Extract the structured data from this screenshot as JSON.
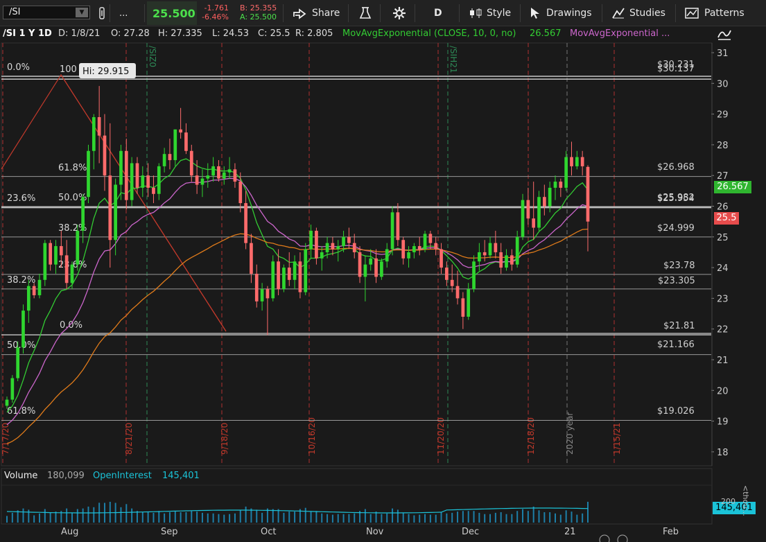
{
  "toolbar": {
    "symbol": "/SI",
    "ellipsis": "...",
    "last": "25.500",
    "net_change": "-1.761",
    "pct_change": "-6.46%",
    "bid": "B: 25.355",
    "ask": "A: 25.500",
    "share": "Share",
    "aggregation": "D",
    "style": "Style",
    "drawings": "Drawings",
    "studies": "Studies",
    "patterns": "Patterns"
  },
  "info": {
    "symbol_period": "/SI 1 Y 1D",
    "date": "D: 1/8/21",
    "open": "O: 27.28",
    "high": "H: 27.335",
    "low": "L: 24.53",
    "close": "C: 25.5",
    "range": "R: 2.805",
    "ema1": "MovAvgExponential (CLOSE, 10, 0, no)",
    "ema1_value": "26.567",
    "ema2": "MovAvgExponential ..."
  },
  "price_axis": [
    "31",
    "30",
    "29",
    "28",
    "27",
    "26",
    "25",
    "24",
    "23",
    "22",
    "21",
    "20",
    "19",
    "18"
  ],
  "time_axis": [
    "Aug",
    "Sep",
    "Oct",
    "Nov",
    "Dec",
    "21",
    "Feb"
  ],
  "levels": [
    {
      "label": "$30.231"
    },
    {
      "label": "$30.137"
    },
    {
      "label": "$26.968"
    },
    {
      "label": "$25.982"
    },
    {
      "label": "$25.954"
    },
    {
      "label": "$24.999"
    },
    {
      "label": "$23.78"
    },
    {
      "label": "$23.305"
    },
    {
      "label": "$21.81"
    },
    {
      "label": "$21.166"
    },
    {
      "label": "$19.026"
    }
  ],
  "fib_labels": [
    "0.0%",
    "100",
    "61.8%",
    "50.0%",
    "23.6%",
    "38.2%",
    "23.6%",
    "38.2%",
    "0.0%",
    "50.0%",
    "61.8%"
  ],
  "hi_tooltip": "Hi: 29.915",
  "vertical_labels": [
    "7/17/20",
    "8/21/20",
    "9/18/20",
    "10/16/20",
    "11/20/20",
    "12/18/20",
    "2020 year",
    "1/15/21"
  ],
  "expiry_labels": [
    "/SIZ0",
    "/SIH21"
  ],
  "price_boxes": {
    "ema": "26.567",
    "last": "25.5"
  },
  "volume": {
    "label": "Volume",
    "value": "180,099",
    "oi_label": "OpenInterest",
    "oi_value": "145,401",
    "axis_label": "200",
    "unit": "<thou...",
    "oi_box": "145,401"
  },
  "colors": {
    "up": "#2fd62f",
    "down": "#ff6b6b",
    "ema10": "#33cc33",
    "ema_mid": "#cc66cc",
    "ema_slow": "#e07b1a",
    "bg": "#1a1a1a",
    "oi": "#1bc3d8"
  },
  "chart_data": {
    "type": "candlestick",
    "title": "/SI 1 Y 1D",
    "ylim": [
      18,
      31.5
    ],
    "candles": [
      [
        19.5,
        19.8,
        19.4,
        19.7
      ],
      [
        19.7,
        20.5,
        19.6,
        20.4
      ],
      [
        20.4,
        21.6,
        20.3,
        21.4
      ],
      [
        21.4,
        22.8,
        21.2,
        22.6
      ],
      [
        22.6,
        23.6,
        22.2,
        23.4
      ],
      [
        23.4,
        23.5,
        23.0,
        23.1
      ],
      [
        23.1,
        23.8,
        23.0,
        23.6
      ],
      [
        23.6,
        24.9,
        23.4,
        24.8
      ],
      [
        24.8,
        24.9,
        23.9,
        24.1
      ],
      [
        24.1,
        24.9,
        23.8,
        24.7
      ],
      [
        24.7,
        25.2,
        24.0,
        24.4
      ],
      [
        24.4,
        24.9,
        23.3,
        23.5
      ],
      [
        23.5,
        24.2,
        23.3,
        24.1
      ],
      [
        24.1,
        25.4,
        23.9,
        25.2
      ],
      [
        25.2,
        26.4,
        24.8,
        26.3
      ],
      [
        26.3,
        28.0,
        26.1,
        27.8
      ],
      [
        27.8,
        29.0,
        27.2,
        28.9
      ],
      [
        28.9,
        29.915,
        27.4,
        28.3
      ],
      [
        28.3,
        29.0,
        26.5,
        27.0
      ],
      [
        27.0,
        28.7,
        24.0,
        24.9
      ],
      [
        24.9,
        26.9,
        24.4,
        26.7
      ],
      [
        26.7,
        28.0,
        26.2,
        27.8
      ],
      [
        27.8,
        28.2,
        25.9,
        26.2
      ],
      [
        26.2,
        27.6,
        26.0,
        27.4
      ],
      [
        27.4,
        27.6,
        26.4,
        26.6
      ],
      [
        26.6,
        27.3,
        26.3,
        27.0
      ],
      [
        27.0,
        27.4,
        26.3,
        26.6
      ],
      [
        26.6,
        27.0,
        26.1,
        26.4
      ],
      [
        26.4,
        27.4,
        26.2,
        27.3
      ],
      [
        27.3,
        27.9,
        27.1,
        27.7
      ],
      [
        27.7,
        28.2,
        27.2,
        27.5
      ],
      [
        27.5,
        28.5,
        27.3,
        28.5
      ],
      [
        28.5,
        29.2,
        28.2,
        28.4
      ],
      [
        28.4,
        28.7,
        27.7,
        27.8
      ],
      [
        27.8,
        28.0,
        26.8,
        27.0
      ],
      [
        27.0,
        27.5,
        26.4,
        26.7
      ],
      [
        26.7,
        27.2,
        26.3,
        26.9
      ],
      [
        26.9,
        27.4,
        26.6,
        27.0
      ],
      [
        27.0,
        27.6,
        26.8,
        27.3
      ],
      [
        27.3,
        27.5,
        26.8,
        26.9
      ],
      [
        26.9,
        27.3,
        26.7,
        27.1
      ],
      [
        27.1,
        27.6,
        26.9,
        27.2
      ],
      [
        27.2,
        27.4,
        26.6,
        26.8
      ],
      [
        26.8,
        27.1,
        25.8,
        26.1
      ],
      [
        26.1,
        26.5,
        24.6,
        24.8
      ],
      [
        24.8,
        25.1,
        23.5,
        23.8
      ],
      [
        23.8,
        24.1,
        22.7,
        22.9
      ],
      [
        22.9,
        23.5,
        22.6,
        23.3
      ],
      [
        23.3,
        23.4,
        21.8,
        23.0
      ],
      [
        23.0,
        24.4,
        22.9,
        24.2
      ],
      [
        24.2,
        24.6,
        23.1,
        23.3
      ],
      [
        23.3,
        24.1,
        23.2,
        24.0
      ],
      [
        24.0,
        24.5,
        23.4,
        23.6
      ],
      [
        23.6,
        24.4,
        23.3,
        24.2
      ],
      [
        24.2,
        24.5,
        23.0,
        23.2
      ],
      [
        23.2,
        24.8,
        23.1,
        24.6
      ],
      [
        24.6,
        25.4,
        24.3,
        25.2
      ],
      [
        25.2,
        25.3,
        24.1,
        24.3
      ],
      [
        24.3,
        24.7,
        23.9,
        24.5
      ],
      [
        24.5,
        25.0,
        24.3,
        24.8
      ],
      [
        24.8,
        25.0,
        24.4,
        24.6
      ],
      [
        24.6,
        24.9,
        24.2,
        24.7
      ],
      [
        24.7,
        25.2,
        24.5,
        25.0
      ],
      [
        25.0,
        25.3,
        24.6,
        24.8
      ],
      [
        24.8,
        25.1,
        24.3,
        24.5
      ],
      [
        24.5,
        24.7,
        23.5,
        23.7
      ],
      [
        23.7,
        24.4,
        22.9,
        24.1
      ],
      [
        24.1,
        24.6,
        23.9,
        24.3
      ],
      [
        24.3,
        24.6,
        23.5,
        23.7
      ],
      [
        23.7,
        24.3,
        23.6,
        24.2
      ],
      [
        24.2,
        24.8,
        24.0,
        24.6
      ],
      [
        24.6,
        26.0,
        24.4,
        25.8
      ],
      [
        25.8,
        26.1,
        24.7,
        24.9
      ],
      [
        24.9,
        25.0,
        24.1,
        24.3
      ],
      [
        24.3,
        24.7,
        24.0,
        24.5
      ],
      [
        24.5,
        24.8,
        24.3,
        24.7
      ],
      [
        24.7,
        25.0,
        24.4,
        24.6
      ],
      [
        24.6,
        25.2,
        24.5,
        25.1
      ],
      [
        25.1,
        25.2,
        24.6,
        24.8
      ],
      [
        24.8,
        25.0,
        24.4,
        24.6
      ],
      [
        24.6,
        24.8,
        23.8,
        24.0
      ],
      [
        24.0,
        24.2,
        23.4,
        23.6
      ],
      [
        23.6,
        24.1,
        23.2,
        23.4
      ],
      [
        23.4,
        23.9,
        22.8,
        23.0
      ],
      [
        23.0,
        23.2,
        22.0,
        22.4
      ],
      [
        22.4,
        23.5,
        22.3,
        23.3
      ],
      [
        23.3,
        24.4,
        23.2,
        24.2
      ],
      [
        24.2,
        24.8,
        23.9,
        24.5
      ],
      [
        24.5,
        24.9,
        24.2,
        24.4
      ],
      [
        24.4,
        25.0,
        24.3,
        24.8
      ],
      [
        24.8,
        25.2,
        24.3,
        24.5
      ],
      [
        24.5,
        24.8,
        23.8,
        24.0
      ],
      [
        24.0,
        24.6,
        23.9,
        24.4
      ],
      [
        24.4,
        24.6,
        23.9,
        24.1
      ],
      [
        24.1,
        25.2,
        24.0,
        25.0
      ],
      [
        25.0,
        26.4,
        24.9,
        26.2
      ],
      [
        26.2,
        26.6,
        25.4,
        25.6
      ],
      [
        25.6,
        26.8,
        24.9,
        25.3
      ],
      [
        25.3,
        26.5,
        25.2,
        26.3
      ],
      [
        26.3,
        26.7,
        25.7,
        26.0
      ],
      [
        26.0,
        26.8,
        25.8,
        26.6
      ],
      [
        26.6,
        27.0,
        26.2,
        26.8
      ],
      [
        26.8,
        26.9,
        26.3,
        26.6
      ],
      [
        26.6,
        27.8,
        26.5,
        27.6
      ],
      [
        27.6,
        28.1,
        27.0,
        27.3
      ],
      [
        27.3,
        27.8,
        27.2,
        27.6
      ],
      [
        27.6,
        27.8,
        27.0,
        27.3
      ],
      [
        27.28,
        27.335,
        24.53,
        25.5
      ]
    ],
    "ema10_last": 26.567,
    "last_close": 25.5
  }
}
